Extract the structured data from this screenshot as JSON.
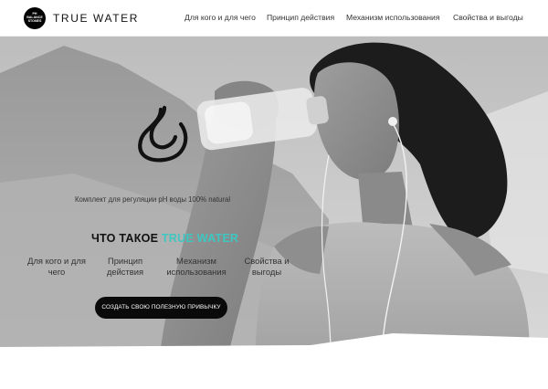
{
  "header": {
    "logo_lines": [
      "PH",
      "BALANCE",
      "STONES"
    ],
    "brand_name": "TRUE WATER",
    "nav": [
      "Для кого и для чего",
      "Принцип действия",
      "Механизм использования",
      "Свойства и выгоды"
    ]
  },
  "hero": {
    "tagline": "Комплект для регуляции pH воды 100% natural",
    "title_prefix": "ЧТО ТАКОЕ",
    "title_accent": "TRUE WATER",
    "features": [
      "Для кого и для чего",
      "Принцип действия",
      "Механизм использования",
      "Свойства и выгоды"
    ],
    "cta_label": "СОЗДАТЬ СВОЮ ПОЛЕЗНУЮ ПРИВЫЧКУ"
  },
  "icons": [
    "water-drop-icon"
  ],
  "colors": {
    "accent": "#3ec6c0",
    "button": "#0a0a0a",
    "text": "#111111"
  }
}
